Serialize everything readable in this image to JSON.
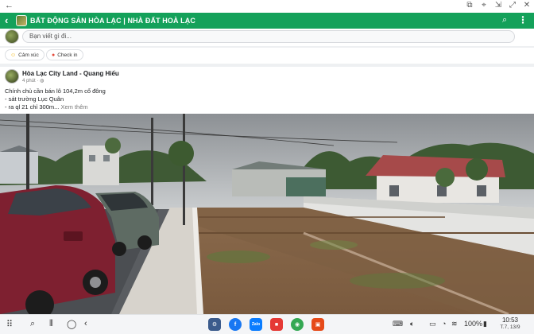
{
  "window": {
    "back_icon": "arrow-left-icon",
    "controls": [
      "pin-icon",
      "pin2-icon",
      "minimize-icon",
      "restore-icon",
      "close-icon"
    ]
  },
  "group_header": {
    "title": "BẤT ĐỘNG SẢN HÒA LẠC | NHÀ ĐẤT HOÀ LẠC",
    "back_icon": "chevron-left-icon",
    "search_icon": "search-icon",
    "menu_icon": "more-vertical-icon",
    "color": "#14a15a"
  },
  "composer": {
    "placeholder": "Bạn viết gì đi..."
  },
  "chips": [
    {
      "label": "Cảm xúc",
      "icon": "smile-icon",
      "color": "#f5b400"
    },
    {
      "label": "Check in",
      "icon": "location-pin-icon",
      "color": "#e44b3c"
    }
  ],
  "post": {
    "author": "Hòa Lạc City Land - Quang Hiếu",
    "time": "4 phút · ",
    "time_icon": "globe-icon",
    "lines": [
      "Chính chủ cần bán lô 104,2m cổ đông",
      "- sát trường Lục Quân",
      "- ra ql 21 chỉ 300m..."
    ],
    "more": " Xem thêm",
    "photo_alt": "land-photo"
  },
  "taskbar": {
    "nav": [
      "apps-grid-icon",
      "search-icon",
      "recents-icon",
      "home-icon",
      "back-icon"
    ],
    "apps": [
      {
        "name": "settings-app",
        "label": "⚙",
        "color": "#3b5b8c"
      },
      {
        "name": "facebook-app",
        "label": "f",
        "color": "#1877f2"
      },
      {
        "name": "zalo-app",
        "label": "Zalo",
        "color": "#0a7cff"
      },
      {
        "name": "app-red",
        "label": "■",
        "color": "#e53935"
      },
      {
        "name": "chrome-app",
        "label": "◉",
        "color": "#34a853"
      },
      {
        "name": "app-red2",
        "label": "▣",
        "color": "#e64a19"
      }
    ],
    "tray": [
      "keyboard-icon",
      "volume-icon",
      "screenshot-icon",
      "notification-icon",
      "wifi-icon"
    ],
    "battery": "100%",
    "time": "10:53",
    "date": "T.7, 13/9"
  }
}
